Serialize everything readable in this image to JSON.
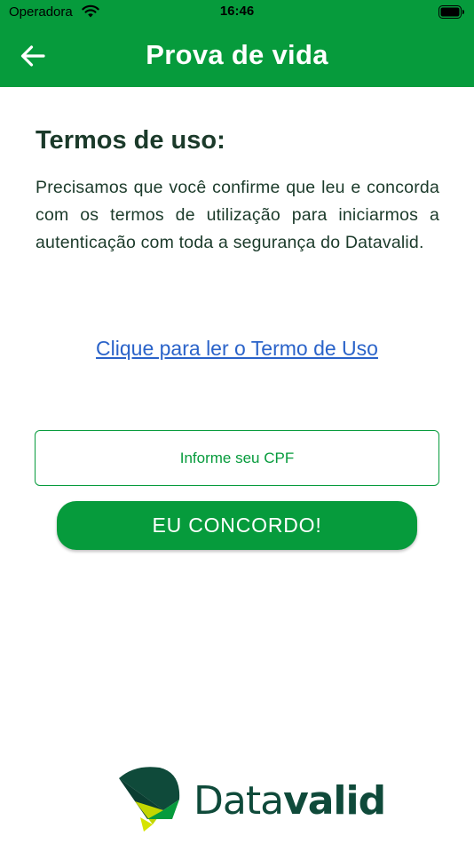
{
  "status_bar": {
    "carrier": "Operadora",
    "time": "16:46"
  },
  "header": {
    "title": "Prova de vida",
    "back_icon": "arrow-left-icon"
  },
  "main": {
    "section_title": "Termos de uso:",
    "description": "Precisamos que você confirme que leu e concorda com os termos de utilização para iniciarmos a autenticação com toda a segurança do Datavalid.",
    "terms_link": "Clique para ler o Termo de Uso",
    "cpf_placeholder": "Informe seu CPF",
    "agree_button": "EU CONCORDO!"
  },
  "footer": {
    "logo_text_light": "Data",
    "logo_text_bold": "valid"
  },
  "colors": {
    "primary_green": "#069b3c",
    "dark_green": "#1b3a2a",
    "link_blue": "#2a63c9",
    "logo_green": "#0f4a3a",
    "logo_lime": "#c3d600"
  }
}
